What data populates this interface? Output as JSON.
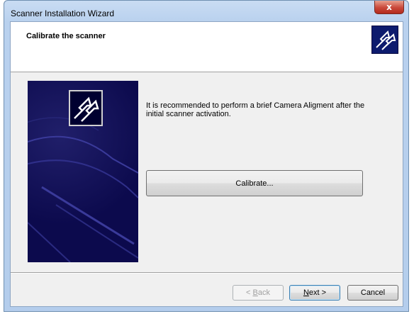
{
  "window": {
    "title": "Scanner Installation Wizard",
    "close_glyph": "x"
  },
  "header": {
    "title": "Calibrate the scanner",
    "logo_icon": "scanner-wizard-logo-icon"
  },
  "main": {
    "description": "It is recommended to perform a brief Camera Aligment after the initial scanner activation.",
    "calibrate_label": "Calibrate..."
  },
  "footer": {
    "back_prefix": "< ",
    "back_mnemonic": "B",
    "back_rest": "ack",
    "next_mnemonic": "N",
    "next_rest": "ext >",
    "cancel_label": "Cancel"
  },
  "colors": {
    "banner_bg": "#0c0a4d",
    "titlebar": "#b9d1ee",
    "close_button": "#c9483a"
  }
}
